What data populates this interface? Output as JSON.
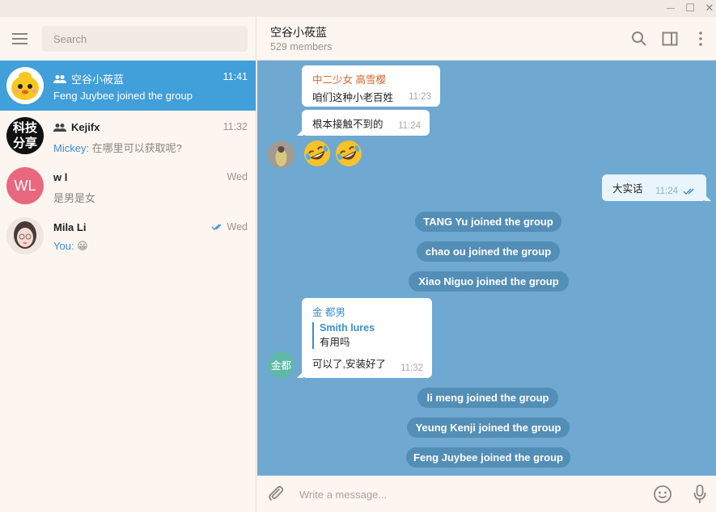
{
  "window": {
    "minimize": "—",
    "maximize": "☐",
    "close": "✕"
  },
  "search": {
    "placeholder": "Search"
  },
  "chats": [
    {
      "name": "空谷小莜蓝",
      "time": "11:41",
      "sender": "",
      "preview": "Feng Juybee joined the group",
      "is_group": true,
      "active": true
    },
    {
      "name": "Kejifx",
      "time": "11:32",
      "sender": "Mickey:",
      "preview": " 在哪里可以获取呢?",
      "is_group": true,
      "active": false,
      "avatar_text_1": "科技",
      "avatar_text_2": "分享"
    },
    {
      "name": "w l",
      "time": "Wed",
      "sender": "",
      "preview": "是男是女",
      "is_group": false,
      "active": false,
      "avatar_initials": "WL"
    },
    {
      "name": "Mila Li",
      "time": "Wed",
      "sender": "You:",
      "preview": " 😀",
      "is_group": false,
      "active": false,
      "read": true
    }
  ],
  "header": {
    "title": "空谷小莜蓝",
    "subtitle": "529 members"
  },
  "messages": {
    "m1": {
      "name": "中二少女 高雪樱",
      "text": "咱们这种小老百姓",
      "time": "11:23"
    },
    "m2": {
      "text": "根本接触不到的",
      "time": "11:24"
    },
    "m3": {
      "text": "大实话",
      "time": "11:24"
    },
    "service": [
      "TANG Yu joined the group",
      "chao ou joined the group",
      "Xiao Niguo joined the group",
      "li meng joined the group",
      "Yeung Kenji joined the group",
      "Feng Juybee joined the group"
    ],
    "m4": {
      "name": "金 都男",
      "reply_name": "Smith lures",
      "reply_text": "有用吗",
      "text": "可以了,安装好了",
      "time": "11:32",
      "avatar_text": "金都"
    }
  },
  "composer": {
    "placeholder": "Write a message..."
  },
  "colors": {
    "accent": "#419fd9",
    "chat_bg": "#6fa8d0",
    "orange_name": "#d1652b",
    "blue_name": "#3a8fcb",
    "avatar_pink": "#e9677f",
    "avatar_teal": "#5fb8a8"
  }
}
